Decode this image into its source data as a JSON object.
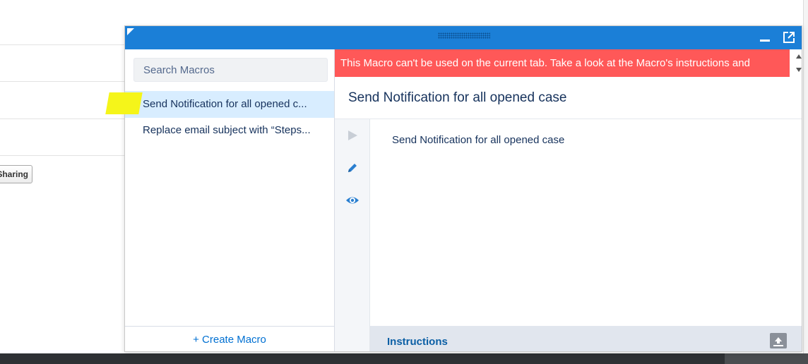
{
  "background": {
    "sharing_button_label": "Sharing"
  },
  "macro_panel": {
    "search": {
      "placeholder": "Search Macros"
    },
    "macros": [
      {
        "label": "Send Notification for all opened c..."
      },
      {
        "label": "Replace email subject with “Steps..."
      }
    ],
    "create_macro_label": "+ Create Macro",
    "error_banner": "This Macro can't be used on the current tab. Take a look at the Macro's instructions and",
    "detail": {
      "title": "Send Notification for all opened case",
      "description": "Send Notification for all opened case",
      "instructions_label": "Instructions"
    },
    "icons": [
      "play-icon",
      "edit-icon",
      "preview-icon",
      "minimize-icon",
      "popout-icon",
      "expand-icon"
    ]
  },
  "colors": {
    "header": "#1b7fd7",
    "error": "#ff5858",
    "selection": "#d8edff",
    "link": "#0070d2",
    "text": "#16325c"
  }
}
